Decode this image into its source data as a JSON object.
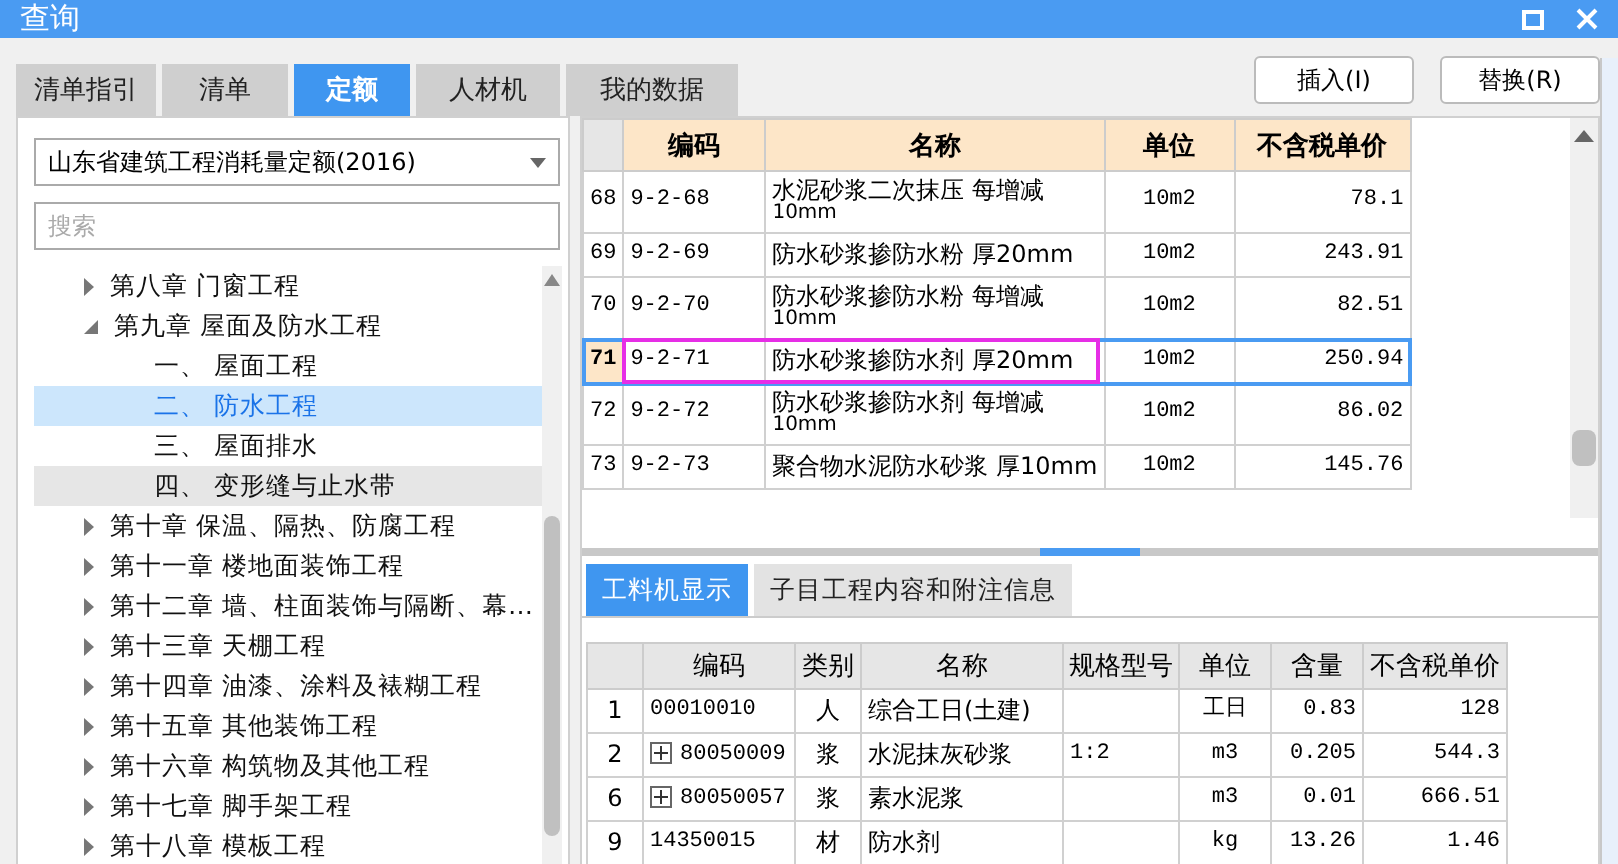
{
  "window": {
    "title": "查询"
  },
  "tabs": [
    {
      "label": "清单指引",
      "selected": false
    },
    {
      "label": "清单",
      "selected": false
    },
    {
      "label": "定额",
      "selected": true
    },
    {
      "label": "人材机",
      "selected": false
    },
    {
      "label": "我的数据",
      "selected": false
    }
  ],
  "buttons": [
    "插入(I)",
    "替换(R)"
  ],
  "library_select": {
    "value": "山东省建筑工程消耗量定额(2016)"
  },
  "search": {
    "placeholder": "搜索"
  },
  "tree": [
    {
      "label": "第八章  门窗工程",
      "expanded": false,
      "selected": false,
      "hovered": false
    },
    {
      "label": "第九章  屋面及防水工程",
      "expanded": true,
      "selected": false,
      "hovered": false,
      "children": [
        {
          "label": "一、  屋面工程",
          "selected": false,
          "hovered": false
        },
        {
          "label": "二、  防水工程",
          "selected": true,
          "hovered": false
        },
        {
          "label": "三、  屋面排水",
          "selected": false,
          "hovered": false
        },
        {
          "label": "四、  变形缝与止水带",
          "selected": false,
          "hovered": true
        }
      ]
    },
    {
      "label": "第十章  保温、隔热、防腐工程",
      "expanded": false,
      "selected": false,
      "hovered": false
    },
    {
      "label": "第十一章  楼地面装饰工程",
      "expanded": false,
      "selected": false,
      "hovered": false
    },
    {
      "label": "第十二章  墙、柱面装饰与隔断、幕…",
      "expanded": false,
      "selected": false,
      "hovered": false
    },
    {
      "label": "第十三章  天棚工程",
      "expanded": false,
      "selected": false,
      "hovered": false
    },
    {
      "label": "第十四章  油漆、涂料及裱糊工程",
      "expanded": false,
      "selected": false,
      "hovered": false
    },
    {
      "label": "第十五章  其他装饰工程",
      "expanded": false,
      "selected": false,
      "hovered": false
    },
    {
      "label": "第十六章  构筑物及其他工程",
      "expanded": false,
      "selected": false,
      "hovered": false
    },
    {
      "label": "第十七章  脚手架工程",
      "expanded": false,
      "selected": false,
      "hovered": false
    },
    {
      "label": "第十八章  模板工程",
      "expanded": false,
      "selected": false,
      "hovered": false
    }
  ],
  "quota_table": {
    "columns": [
      "编码",
      "名称",
      "单位",
      "不含税单价"
    ],
    "rows": [
      {
        "index": "68",
        "code": "9-2-68",
        "name": "水泥砂浆二次抹压  每增减",
        "name_note": "10mm",
        "unit": "10m2",
        "price": "78.1",
        "selected": false,
        "annotated": false
      },
      {
        "index": "69",
        "code": "9-2-69",
        "name": "防水砂浆掺防水粉  厚20mm",
        "unit": "10m2",
        "price": "243.91",
        "selected": false,
        "annotated": false
      },
      {
        "index": "70",
        "code": "9-2-70",
        "name": "防水砂浆掺防水粉  每增减",
        "name_note": "10mm",
        "unit": "10m2",
        "price": "82.51",
        "selected": false,
        "annotated": false
      },
      {
        "index": "71",
        "code": "9-2-71",
        "name": "防水砂浆掺防水剂  厚20mm",
        "unit": "10m2",
        "price": "250.94",
        "selected": true,
        "annotated": true
      },
      {
        "index": "72",
        "code": "9-2-72",
        "name": "防水砂浆掺防水剂  每增减",
        "name_note": "10mm",
        "unit": "10m2",
        "price": "86.02",
        "selected": false,
        "annotated": false
      },
      {
        "index": "73",
        "code": "9-2-73",
        "name": "聚合物水泥防水砂浆  厚10mm",
        "unit": "10m2",
        "price": "145.76",
        "selected": false,
        "annotated": false
      }
    ]
  },
  "detail_tabs": [
    {
      "label": "工料机显示",
      "selected": true
    },
    {
      "label": "子目工程内容和附注信息",
      "selected": false
    }
  ],
  "resource_table": {
    "columns": [
      "编码",
      "类别",
      "名称",
      "规格型号",
      "单位",
      "含量",
      "不含税单价"
    ],
    "rows": [
      {
        "index": "1",
        "code": "00010010",
        "expandable": false,
        "category": "人",
        "name": "综合工日(土建)",
        "spec": "",
        "unit": "工日",
        "amount": "0.83",
        "price": "128"
      },
      {
        "index": "2",
        "code": "80050009",
        "expandable": true,
        "category": "浆",
        "name": "水泥抹灰砂浆",
        "spec": "1:2",
        "unit": "m3",
        "amount": "0.205",
        "price": "544.3"
      },
      {
        "index": "6",
        "code": "80050057",
        "expandable": true,
        "category": "浆",
        "name": "素水泥浆",
        "spec": "",
        "unit": "m3",
        "amount": "0.01",
        "price": "666.51"
      },
      {
        "index": "9",
        "code": "14350015",
        "expandable": false,
        "category": "材",
        "name": "防水剂",
        "spec": "",
        "unit": "kg",
        "amount": "13.26",
        "price": "1.46"
      }
    ]
  }
}
